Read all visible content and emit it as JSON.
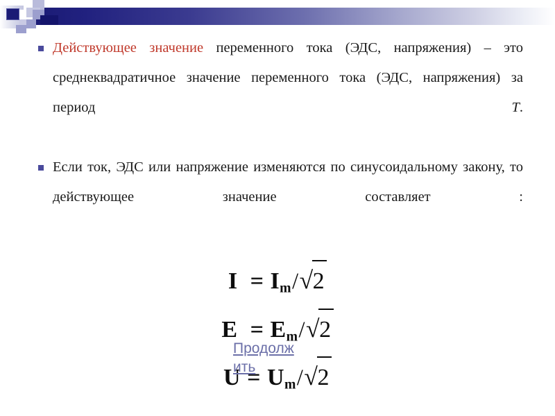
{
  "slide": {
    "decor": {
      "bar_gradient_start": "#1b1b75",
      "bar_gradient_end": "#ffffff",
      "square_navy": "#1b1b75",
      "square_periwinkle": "#9c9fce",
      "square_lavender": "#c6c8e2"
    },
    "bullets": [
      {
        "marker": "square-bullet",
        "segments": [
          {
            "text": "Действующее значение",
            "style": "red"
          },
          {
            "text": " переменного тока (ЭДС, напряжения) – это среднеквадратичное значение переменного тока (ЭДС, напряжения) за период ",
            "style": "normal"
          },
          {
            "text": "T",
            "style": "italic"
          },
          {
            "text": ".",
            "style": "normal"
          }
        ],
        "plain_text": "Действующее значение переменного тока (ЭДС, напряжения) – это среднеквадратичное значение переменного тока (ЭДС, напряжения) за период T."
      },
      {
        "marker": "square-bullet",
        "segments": [
          {
            "text": "Если ток, ЭДС или напряжение изменяются по синусоидальному закону, то  действующее значение составляет :",
            "style": "normal"
          }
        ],
        "plain_text": "Если ток, ЭДС или напряжение изменяются по синусоидальному закону, то  действующее значение составляет :"
      }
    ],
    "formulas": [
      {
        "lhs": "I",
        "eq": "=",
        "numerator": "I",
        "subscript": "m",
        "slash": "/",
        "radical": "√",
        "radicand": "2"
      },
      {
        "lhs": "E",
        "eq": "=",
        "numerator": "E",
        "subscript": "m",
        "slash": "/",
        "radical": "√",
        "radicand": "2"
      },
      {
        "lhs": "U",
        "eq": "=",
        "numerator": "U",
        "subscript": "m",
        "slash": "/",
        "radical": "√",
        "radicand": "2"
      }
    ],
    "link": {
      "label": "Продолжить",
      "color": "#6b6fa8"
    },
    "colors": {
      "accent_red": "#c0392b",
      "text": "#1a1a1a",
      "bullet_marker": "#4a4a9c",
      "background": "#ffffff"
    }
  }
}
